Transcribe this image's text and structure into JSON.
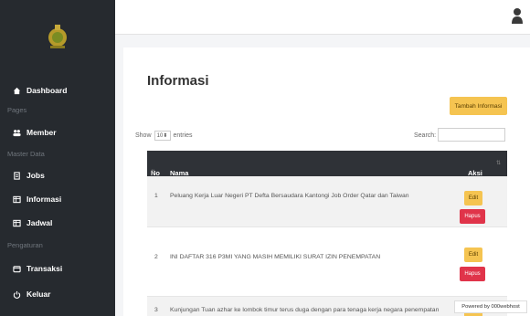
{
  "sidebar": {
    "logo_icon": "emblem-logo",
    "dashboard_label": "Dashboard",
    "section_pages": "Pages",
    "member_label": "Member",
    "section_master": "Master Data",
    "jobs_label": "Jobs",
    "informasi_label": "Informasi",
    "jadwal_label": "Jadwal",
    "section_pengaturan": "Pengaturan",
    "transaksi_label": "Transaksi",
    "keluar_label": "Keluar"
  },
  "main": {
    "title": "Informasi",
    "add_button": "Tambah Informasi",
    "show_label": "Show",
    "entries_value": "10",
    "entries_label": "entries",
    "search_label": "Search:",
    "search_value": "",
    "columns": [
      "No",
      "Nama",
      "Aksi"
    ],
    "rows": [
      {
        "no": "1",
        "nama": "Peluang Kerja Luar Negeri PT Defta Bersaudara Kantongi Job Order Qatar dan Taiwan"
      },
      {
        "no": "2",
        "nama": "INI DAFTAR 316 P3MI YANG MASIH MEMILIKI SURAT IZIN PENEMPATAN"
      },
      {
        "no": "3",
        "nama": "Kunjungan Tuan azhar ke lombok timur terus duga dengan para tenaga kerja negara penempatan"
      }
    ],
    "edit_label": "Edit",
    "delete_label": "Hapus"
  },
  "badge": {
    "text": "Powered by 000webhost"
  },
  "colors": {
    "sidebar": "#262a2f",
    "accent": "#f5c451",
    "danger": "#e0344a",
    "table_header": "#2f3237"
  }
}
